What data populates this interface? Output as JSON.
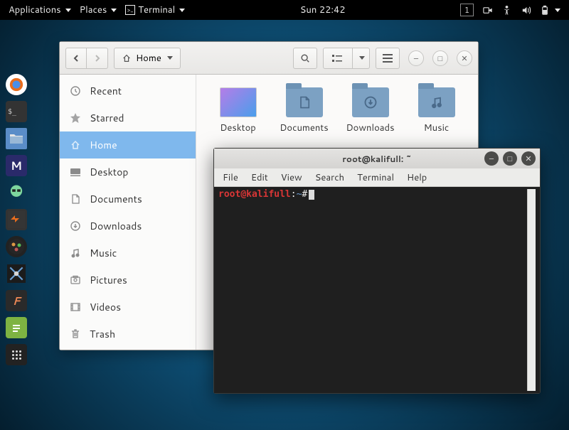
{
  "topbar": {
    "applications": "Applications",
    "places": "Places",
    "terminal": "Terminal",
    "clock": "Sun 22:42",
    "workspace": "1"
  },
  "dock": {
    "items": [
      "firefox",
      "terminal",
      "files",
      "metasploit",
      "armitage-green",
      "armitage",
      "maltego",
      "wireshark",
      "faraday",
      "leafpad",
      "apps"
    ]
  },
  "files": {
    "path_label": "Home",
    "sidebar": [
      {
        "icon": "recent",
        "label": "Recent"
      },
      {
        "icon": "star",
        "label": "Starred"
      },
      {
        "icon": "home",
        "label": "Home"
      },
      {
        "icon": "desktop",
        "label": "Desktop"
      },
      {
        "icon": "documents",
        "label": "Documents"
      },
      {
        "icon": "downloads",
        "label": "Downloads"
      },
      {
        "icon": "music",
        "label": "Music"
      },
      {
        "icon": "pictures",
        "label": "Pictures"
      },
      {
        "icon": "videos",
        "label": "Videos"
      },
      {
        "icon": "trash",
        "label": "Trash"
      }
    ],
    "grid": [
      {
        "type": "desktop",
        "label": "Desktop"
      },
      {
        "type": "folder",
        "glyph": "doc",
        "label": "Documents"
      },
      {
        "type": "folder",
        "glyph": "down",
        "label": "Downloads"
      },
      {
        "type": "folder",
        "glyph": "music",
        "label": "Music"
      }
    ]
  },
  "terminal": {
    "title": "root@kalifull: ~",
    "menu": [
      "File",
      "Edit",
      "View",
      "Search",
      "Terminal",
      "Help"
    ],
    "prompt": {
      "user": "root",
      "at": "@",
      "host": "kalifull",
      "colon": ":",
      "path": "~",
      "symbol": "#"
    }
  }
}
